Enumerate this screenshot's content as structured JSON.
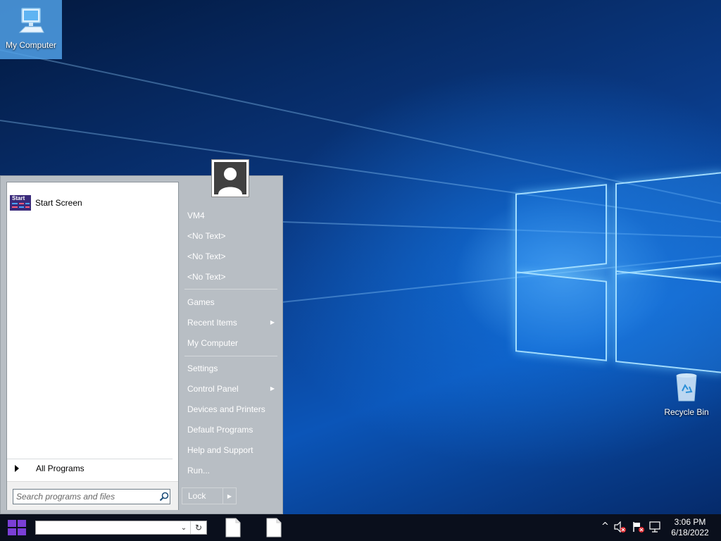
{
  "desktop": {
    "icons": {
      "my_computer": "My Computer",
      "recycle_bin": "Recycle Bin"
    }
  },
  "start_menu": {
    "pinned": [
      {
        "label": "Start Screen",
        "tile_text": "Start",
        "icon": "start-screen-icon"
      }
    ],
    "all_programs": "All Programs",
    "search": {
      "placeholder": "Search programs and files",
      "value": ""
    },
    "user": {
      "icon": "user-avatar-icon"
    },
    "right_items": [
      {
        "label": "VM4",
        "submenu": false
      },
      {
        "label": "<No Text>",
        "submenu": false
      },
      {
        "label": "<No Text>",
        "submenu": false
      },
      {
        "label": "<No Text>",
        "submenu": false
      },
      {
        "label": "Games",
        "submenu": false
      },
      {
        "label": "Recent Items",
        "submenu": true
      },
      {
        "label": "My Computer",
        "submenu": false
      },
      {
        "label": "Settings",
        "submenu": false
      },
      {
        "label": "Control Panel",
        "submenu": true
      },
      {
        "label": "Devices and Printers",
        "submenu": false
      },
      {
        "label": "Default Programs",
        "submenu": false
      },
      {
        "label": "Help and Support",
        "submenu": false
      },
      {
        "label": "Run...",
        "submenu": false
      }
    ],
    "lock": {
      "label": "Lock"
    }
  },
  "taskbar": {
    "address_value": "",
    "clock": {
      "time": "3:06 PM",
      "date": "6/18/2022"
    },
    "tray_icons": [
      "chevron-up-icon",
      "volume-muted-icon",
      "action-center-flag-icon",
      "network-icon"
    ]
  },
  "colors": {
    "start_menu_bg": "#b8bec4",
    "taskbar_bg": "#0a0f1c",
    "windows_logo": "#7b3fd6"
  }
}
